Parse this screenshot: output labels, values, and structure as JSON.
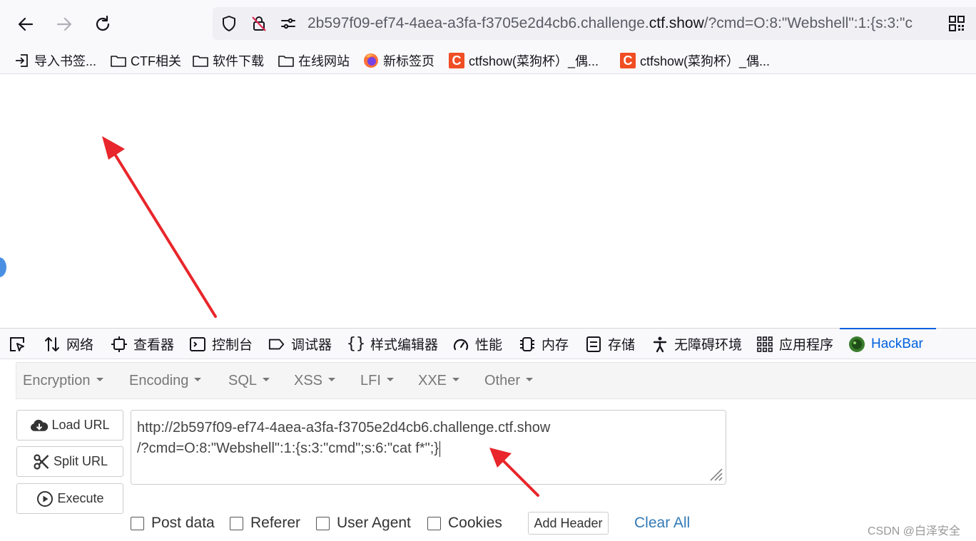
{
  "browser": {
    "url_prefix": "2b597f09-ef74-4aea-a3fa-f3705e2d4cb6.challenge.",
    "url_domain": "ctf.show",
    "url_suffix": "/?cmd=O:8:\"Webshell\":1:{s:3:\"c"
  },
  "bookmarks": [
    {
      "label": "导入书签...",
      "icon": "import-icon"
    },
    {
      "label": "CTF相关",
      "icon": "folder-icon"
    },
    {
      "label": "软件下载",
      "icon": "folder-icon"
    },
    {
      "label": "在线网站",
      "icon": "folder-icon"
    },
    {
      "label": "新标签页",
      "icon": "firefox-icon"
    },
    {
      "label": "ctfshow(菜狗杯）_偶...",
      "icon": "ctfshow-icon"
    },
    {
      "label": "ctfshow(菜狗杯）_偶...",
      "icon": "ctfshow-icon"
    }
  ],
  "devtools": {
    "tabs": [
      {
        "label": "网络",
        "icon": "network-icon"
      },
      {
        "label": "查看器",
        "icon": "inspector-icon"
      },
      {
        "label": "控制台",
        "icon": "console-icon"
      },
      {
        "label": "调试器",
        "icon": "debugger-icon"
      },
      {
        "label": "样式编辑器",
        "icon": "style-editor-icon"
      },
      {
        "label": "性能",
        "icon": "performance-icon"
      },
      {
        "label": "内存",
        "icon": "memory-icon"
      },
      {
        "label": "存储",
        "icon": "storage-icon"
      },
      {
        "label": "无障碍环境",
        "icon": "accessibility-icon"
      },
      {
        "label": "应用程序",
        "icon": "application-icon"
      },
      {
        "label": "HackBar",
        "icon": "hackbar-icon"
      }
    ],
    "active_tab": "HackBar"
  },
  "hackbar": {
    "menu": [
      "Encryption",
      "Encoding",
      "SQL",
      "XSS",
      "LFI",
      "XXE",
      "Other"
    ],
    "load_url": "Load URL",
    "split_url": "Split URL",
    "execute": "Execute",
    "url_line1": "http://2b597f09-ef74-4aea-a3fa-f3705e2d4cb6.challenge.ctf.show",
    "url_line2": "/?cmd=O:8:\"Webshell\":1:{s:3:\"cmd\";s:6:\"cat f*\";}",
    "options": [
      "Post data",
      "Referer",
      "User Agent",
      "Cookies"
    ],
    "add_header": "Add Header",
    "clear_all": "Clear All"
  },
  "watermark": "CSDN @白泽安全",
  "colors": {
    "accent": "#0060df",
    "annotation_arrow": "#e8262b",
    "ctfshow_brand": "#f04e23",
    "link": "#337ab7"
  }
}
